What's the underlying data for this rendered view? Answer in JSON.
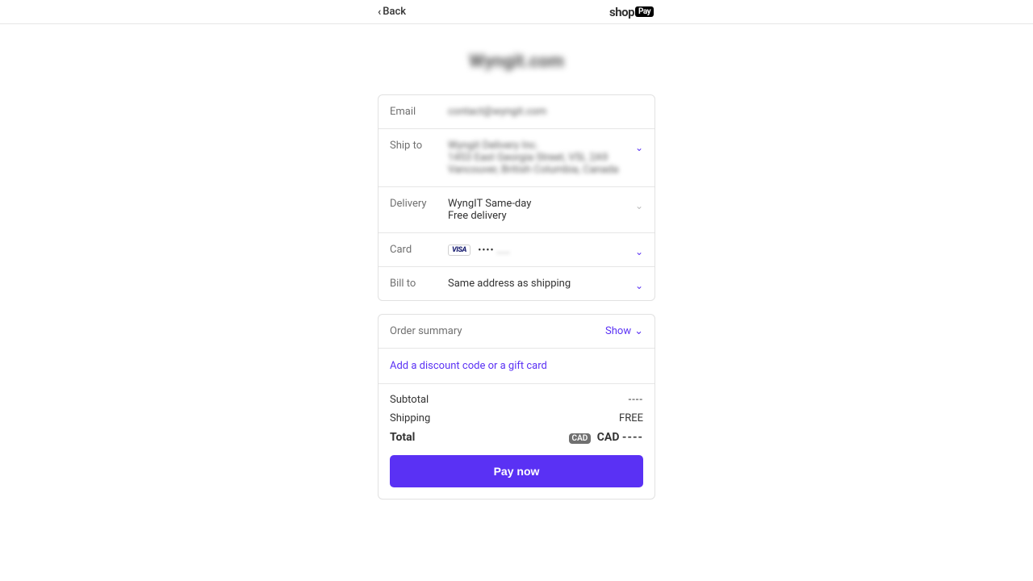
{
  "header": {
    "back_label": "Back",
    "brand_shop": "shop",
    "brand_pay": "Pay"
  },
  "store_name": "Wyngit.com",
  "review": {
    "email_label": "Email",
    "email_value": "contact@wyngit.com",
    "shipto_label": "Ship to",
    "shipto_line1": "Wyngit Delivery Inc.",
    "shipto_line2": "1453 East Georgia Street, V5L 2A9",
    "shipto_line3": "Vancouver, British Columbia, Canada",
    "delivery_label": "Delivery",
    "delivery_line1": "WyngIT Same-day",
    "delivery_line2": "Free delivery",
    "card_label": "Card",
    "card_brand": "VISA",
    "card_dots": "••••",
    "card_last4": "....",
    "billto_label": "Bill to",
    "billto_value": "Same address as shipping"
  },
  "summary": {
    "title": "Order summary",
    "show_label": "Show",
    "discount_link": "Add a discount code or a gift card",
    "subtotal_label": "Subtotal",
    "subtotal_value": "----",
    "shipping_label": "Shipping",
    "shipping_value": "FREE",
    "total_label": "Total",
    "currency_badge": "CAD",
    "total_currency": "CAD",
    "total_value": "----",
    "pay_button": "Pay now"
  }
}
